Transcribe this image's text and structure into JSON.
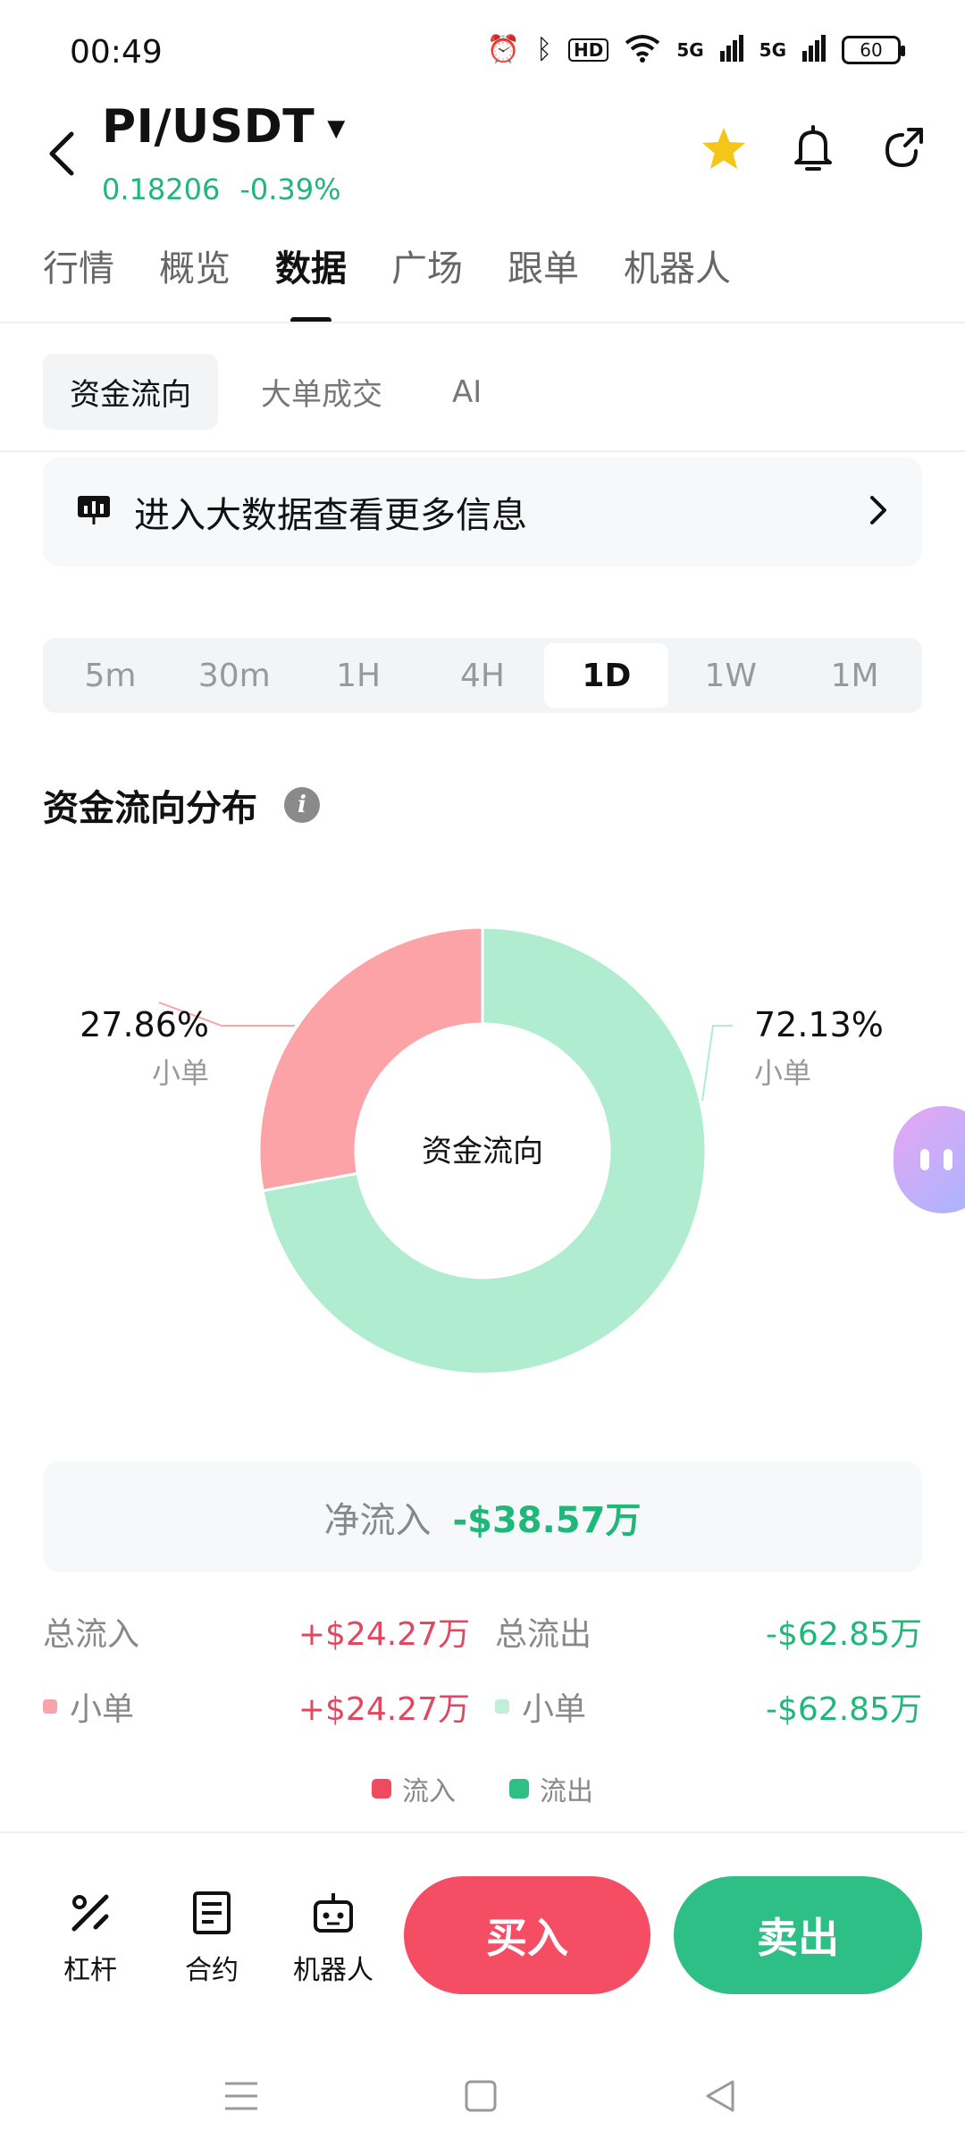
{
  "status_bar": {
    "time": "00:49",
    "hd_badge": "HD",
    "net1": "5G",
    "net2": "5G",
    "battery": "60"
  },
  "header": {
    "pair": "PI/USDT",
    "price": "0.18206",
    "change": "-0.39%",
    "price_color": "#1fb77a",
    "star_color": "#f5c518"
  },
  "main_tabs": [
    {
      "label": "行情",
      "active": false
    },
    {
      "label": "概览",
      "active": false
    },
    {
      "label": "数据",
      "active": true
    },
    {
      "label": "广场",
      "active": false
    },
    {
      "label": "跟单",
      "active": false
    },
    {
      "label": "机器人",
      "active": false
    }
  ],
  "sub_tabs": [
    {
      "label": "资金流向",
      "active": true
    },
    {
      "label": "大单成交",
      "active": false
    },
    {
      "label": "AI",
      "active": false
    }
  ],
  "banner": {
    "text": "进入大数据查看更多信息",
    "icon": "presentation-chart-icon"
  },
  "time_ranges": [
    {
      "label": "5m",
      "active": false
    },
    {
      "label": "30m",
      "active": false
    },
    {
      "label": "1H",
      "active": false
    },
    {
      "label": "4H",
      "active": false
    },
    {
      "label": "1D",
      "active": true
    },
    {
      "label": "1W",
      "active": false
    },
    {
      "label": "1M",
      "active": false
    }
  ],
  "section": {
    "title": "资金流向分布",
    "info_icon": "i"
  },
  "chart_data": {
    "type": "pie",
    "center_label": "资金流向",
    "slices": [
      {
        "label": "小单",
        "percent_text": "27.86%",
        "value": 27.86,
        "color": "#fca3a8"
      },
      {
        "label": "小单",
        "percent_text": "72.13%",
        "value": 72.13,
        "color": "#b0edd0"
      }
    ]
  },
  "net": {
    "label": "净流入",
    "value": "-$38.57万"
  },
  "flows": {
    "total_in_label": "总流入",
    "total_in_value": "+$24.27万",
    "total_out_label": "总流出",
    "total_out_value": "-$62.85万",
    "small_in_label": "小单",
    "small_in_value": "+$24.27万",
    "small_out_label": "小单",
    "small_out_value": "-$62.85万"
  },
  "legend": {
    "inflow": "流入",
    "outflow": "流出",
    "inflow_color": "#f04a60",
    "outflow_color": "#2dbf85"
  },
  "actions": {
    "leverage": "杠杆",
    "contract": "合约",
    "robot": "机器人",
    "buy": "买入",
    "sell": "卖出",
    "buy_color": "#f54d64",
    "sell_color": "#2dbf85"
  }
}
